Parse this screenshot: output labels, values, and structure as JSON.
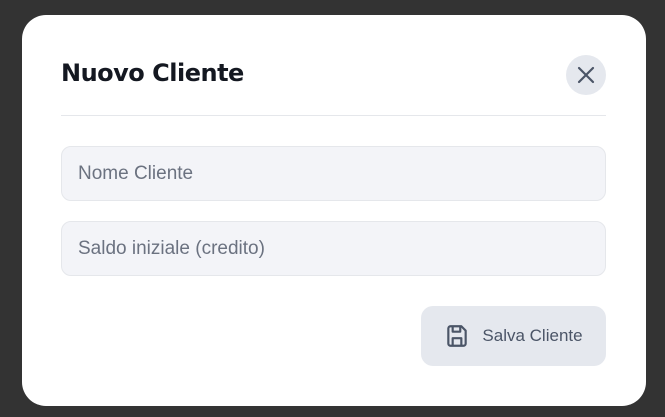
{
  "dialog": {
    "title": "Nuovo Cliente",
    "close_icon": "x-icon",
    "fields": {
      "name": {
        "value": "",
        "placeholder": "Nome Cliente"
      },
      "balance": {
        "value": "",
        "placeholder": "Saldo iniziale (credito)"
      }
    },
    "save_button": {
      "label": "Salva Cliente",
      "icon": "floppy-disk-icon"
    }
  }
}
